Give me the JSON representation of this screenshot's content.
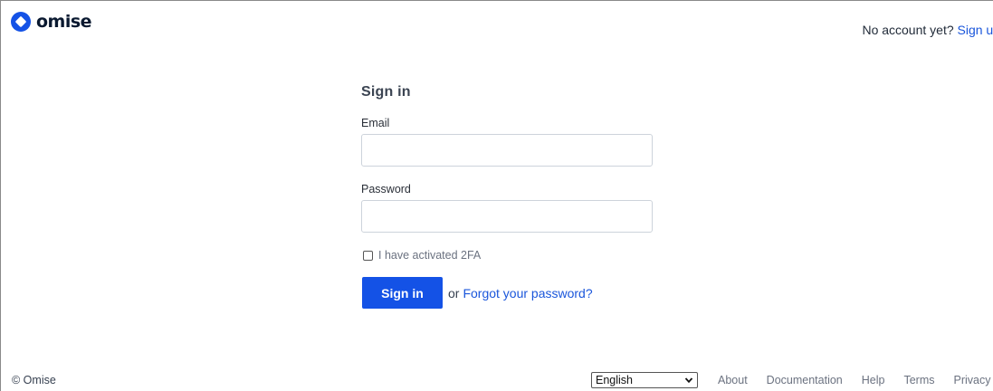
{
  "header": {
    "logo_text": "omise",
    "no_account_text": "No account yet?",
    "signup_link": "Sign up"
  },
  "form": {
    "title": "Sign in",
    "email_label": "Email",
    "email_value": "",
    "password_label": "Password",
    "password_value": "",
    "twofa_label": "I have activated 2FA",
    "twofa_checked": false,
    "submit_label": "Sign in",
    "or_text": "or",
    "forgot_link": "Forgot your password?"
  },
  "footer": {
    "copyright": "© Omise",
    "language_selected": "English",
    "links": [
      "About",
      "Documentation",
      "Help",
      "Terms",
      "Privacy"
    ]
  },
  "colors": {
    "brand_blue": "#1452e6",
    "link_blue": "#1a56db",
    "logo_dark": "#0a1930"
  },
  "icons": {
    "logo": "omise-diamond-logo-icon",
    "select": "chevron-down-icon"
  }
}
